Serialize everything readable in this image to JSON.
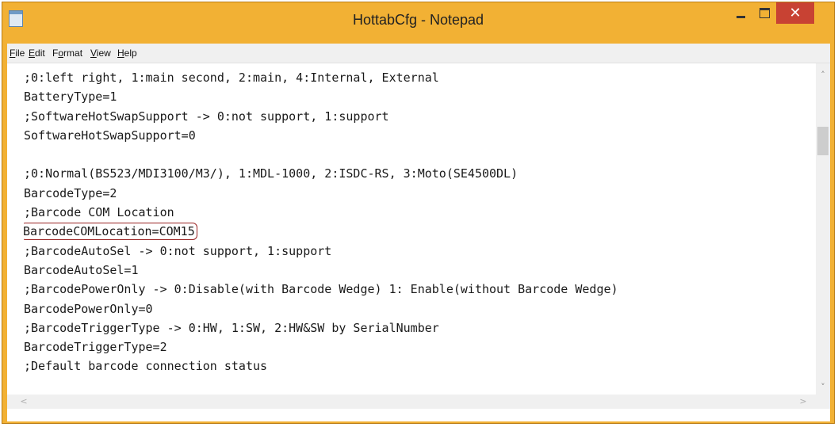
{
  "window": {
    "title": "HottabCfg - Notepad",
    "min_glyph": "minimize",
    "max_glyph": "maximize",
    "close_glyph": "✕",
    "accent": "#f2b134",
    "close_color": "#c84233"
  },
  "menu": {
    "file": {
      "u": "F",
      "rest": "ile"
    },
    "edit": {
      "u": "E",
      "rest": "dit"
    },
    "format": {
      "pre": "F",
      "u": "o",
      "rest": "rmat"
    },
    "view": {
      "u": "V",
      "rest": "iew"
    },
    "help": {
      "u": "H",
      "rest": "elp"
    }
  },
  "document": {
    "lines": [
      ";0:left right, 1:main second, 2:main, 4:Internal, External",
      "BatteryType=1",
      ";SoftwareHotSwapSupport -> 0:not support, 1:support",
      "SoftwareHotSwapSupport=0",
      "",
      ";0:Normal(BS523/MDI3100/M3/), 1:MDL-1000, 2:ISDC-RS, 3:Moto(SE4500DL)",
      "BarcodeType=2",
      ";Barcode COM Location",
      "BarcodeCOMLocation=COM15",
      ";BarcodeAutoSel -> 0:not support, 1:support",
      "BarcodeAutoSel=1",
      ";BarcodePowerOnly -> 0:Disable(with Barcode Wedge) 1: Enable(without Barcode Wedge)",
      "BarcodePowerOnly=0",
      ";BarcodeTriggerType -> 0:HW, 1:SW, 2:HW&SW by SerialNumber",
      "BarcodeTriggerType=2",
      ";Default barcode connection status"
    ],
    "highlighted_line_index": 8,
    "highlight_color": "#9a2424"
  },
  "scrollbars": {
    "up_arrow": "˄",
    "down_arrow": "˅",
    "left_arrow": "<",
    "right_arrow": ">"
  }
}
